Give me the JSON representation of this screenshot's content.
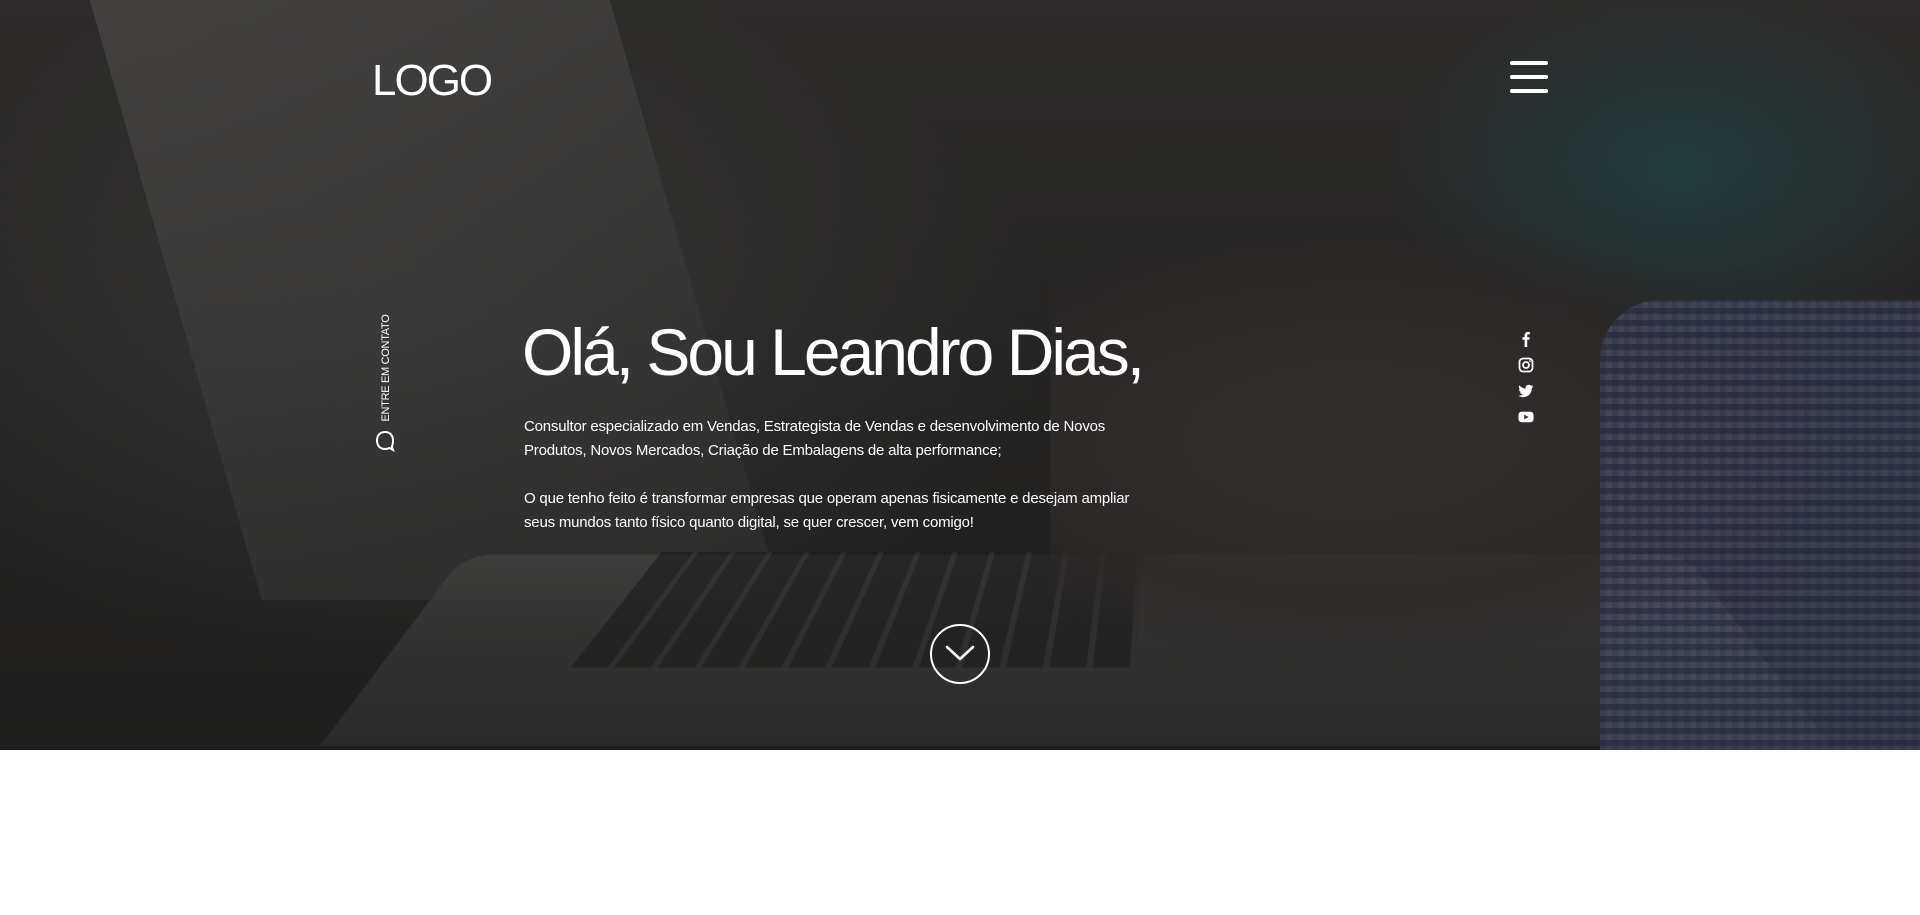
{
  "header": {
    "logo": "LOGO",
    "menu_icon": "hamburger-menu-icon"
  },
  "sidebar": {
    "contact_label": "ENTRE EM CONTATO",
    "contact_icon": "chat-bubble-icon"
  },
  "hero": {
    "title": "Olá, Sou Leandro Dias,",
    "paragraph_1": "Consultor especializado em Vendas, Estrategista de Vendas e desenvolvimento de Novos Produtos, Novos Mercados, Criação de Embalagens de alta performance;",
    "paragraph_2": "O que tenho feito é transformar empresas que operam apenas fisicamente e desejam ampliar seus mundos tanto físico quanto digital, se quer crescer, vem comigo!",
    "scroll_icon": "chevron-down-icon"
  },
  "social": [
    {
      "name": "facebook",
      "icon": "facebook-icon"
    },
    {
      "name": "instagram",
      "icon": "instagram-icon"
    },
    {
      "name": "twitter",
      "icon": "twitter-icon"
    },
    {
      "name": "youtube",
      "icon": "youtube-icon"
    }
  ],
  "colors": {
    "text": "#ffffff",
    "overlay": "#2c2b2a",
    "page_background": "#ffffff"
  }
}
